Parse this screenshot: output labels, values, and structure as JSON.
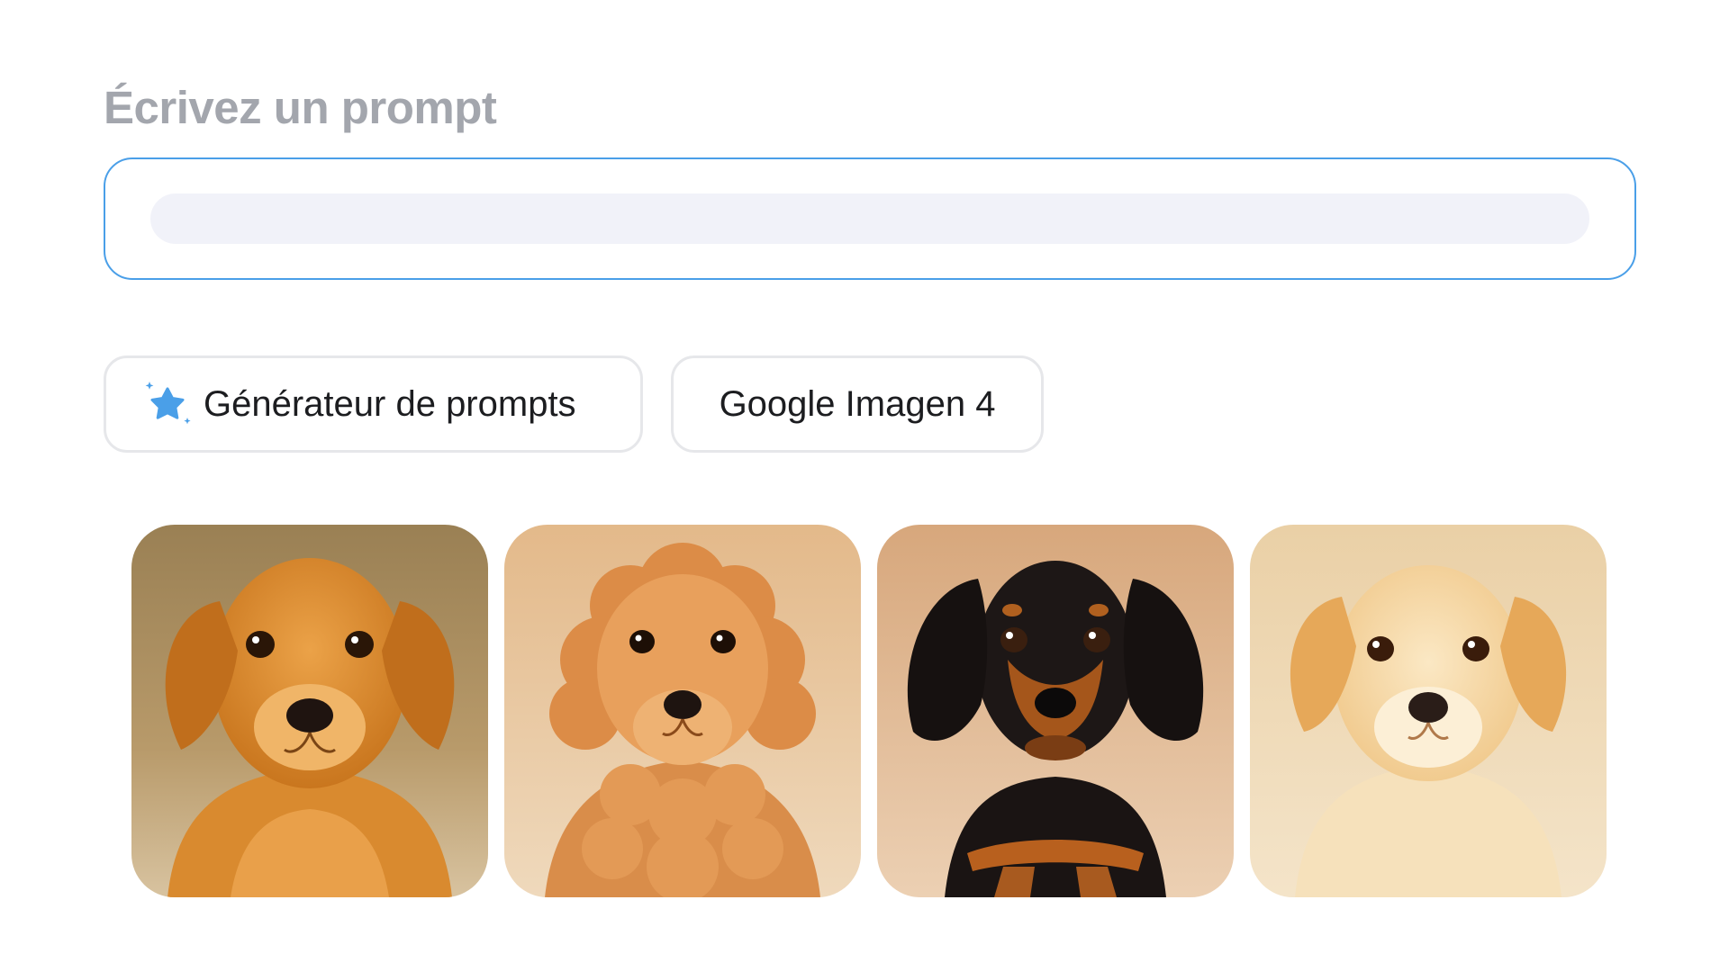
{
  "prompt": {
    "title": "Écrivez un prompt",
    "input_value": "",
    "input_placeholder": ""
  },
  "chips": {
    "generator_label": "Générateur de prompts",
    "generator_icon": "sparkle-star-icon",
    "model_label": "Google Imagen 4"
  },
  "colors": {
    "accent": "#4a9fe8",
    "title_gray": "#a3a6ad",
    "input_fill": "#f1f2f9",
    "chip_border": "#e6e7ea"
  },
  "gallery": {
    "images": [
      {
        "subject": "golden retriever puppy"
      },
      {
        "subject": "curly apricot poodle puppy"
      },
      {
        "subject": "black and tan dachshund puppy"
      },
      {
        "subject": "cream fluffy puppy"
      }
    ]
  }
}
